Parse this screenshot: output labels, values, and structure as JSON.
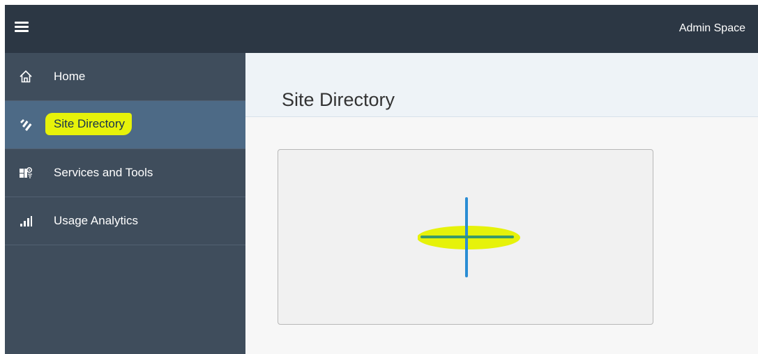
{
  "header": {
    "menu_icon": "hamburger-menu-icon",
    "space_name": "Admin Space"
  },
  "sidebar": {
    "items": [
      {
        "label": "Home",
        "icon": "home-icon",
        "active": false
      },
      {
        "label": "Site Directory",
        "icon": "site-directory-icon",
        "active": true
      },
      {
        "label": "Services and Tools",
        "icon": "services-tools-icon",
        "active": false
      },
      {
        "label": "Usage Analytics",
        "icon": "bar-chart-icon",
        "active": false
      }
    ]
  },
  "main": {
    "title": "Site Directory",
    "add_tile_icon": "plus-icon"
  },
  "colors": {
    "topbar": "#2c3744",
    "sidebar": "#3f4d5c",
    "sidebar_active": "#4d6a86",
    "highlight": "#e6f20a",
    "accent_blue": "#2a8dd4"
  }
}
